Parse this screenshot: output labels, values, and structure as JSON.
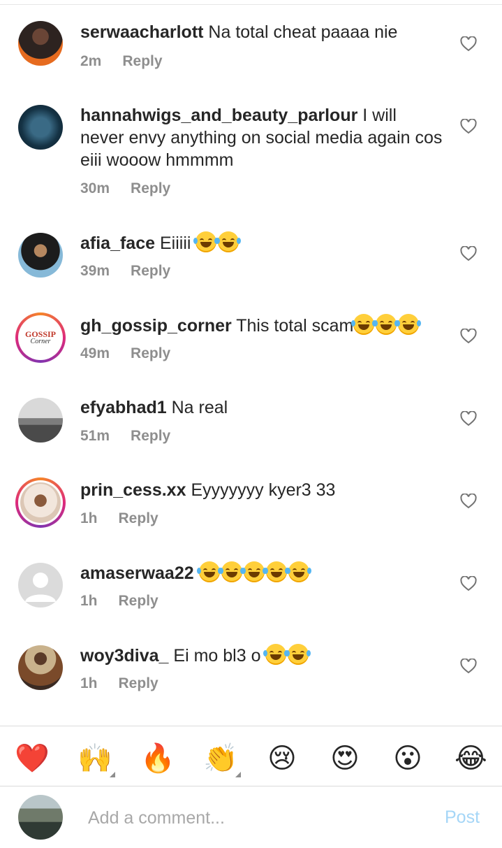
{
  "comments": [
    {
      "username": "serwaacharlott",
      "text": "Na total cheat paaaa nie",
      "emojis": 0,
      "time": "2m",
      "reply": "Reply"
    },
    {
      "username": "hannahwigs_and_beauty_parlour",
      "text": "I will never envy anything on social media again cos eiii wooow  hmmmm",
      "emojis": 0,
      "time": "30m",
      "reply": "Reply"
    },
    {
      "username": "afia_face",
      "text": "Eiiiii",
      "emojis": 2,
      "time": "39m",
      "reply": "Reply"
    },
    {
      "username": "gh_gossip_corner",
      "text": "This total scam",
      "emojis": 3,
      "time": "49m",
      "reply": "Reply",
      "avatar_logo_text": "GOSSIP Corner"
    },
    {
      "username": "efyabhad1",
      "text": "Na real",
      "emojis": 0,
      "time": "51m",
      "reply": "Reply"
    },
    {
      "username": "prin_cess.xx",
      "text": "Eyyyyyyy kyer3 33",
      "emojis": 0,
      "time": "1h",
      "reply": "Reply"
    },
    {
      "username": "amaserwaa22",
      "text": "",
      "emojis": 5,
      "time": "1h",
      "reply": "Reply"
    },
    {
      "username": "woy3diva_",
      "text": "Ei mo bl3 o",
      "emojis": 2,
      "time": "1h",
      "reply": "Reply"
    }
  ],
  "reactions": [
    {
      "icon": "red-heart",
      "glyph": "❤️"
    },
    {
      "icon": "raising-hands",
      "glyph": "🙌"
    },
    {
      "icon": "fire",
      "glyph": "🔥"
    },
    {
      "icon": "clapping-hands",
      "glyph": "👏"
    },
    {
      "icon": "crying-face",
      "glyph": "😢"
    },
    {
      "icon": "heart-eyes-face",
      "glyph": "😍"
    },
    {
      "icon": "surprised-face",
      "glyph": "😮"
    },
    {
      "icon": "tears-of-joy-face",
      "glyph": "😂"
    }
  ],
  "composer": {
    "placeholder": "Add a comment...",
    "post_label": "Post"
  },
  "colors": {
    "text": "#262626",
    "meta": "#8e8e8e",
    "post_disabled": "#a5d6f7",
    "divider": "#dbdbdb"
  }
}
